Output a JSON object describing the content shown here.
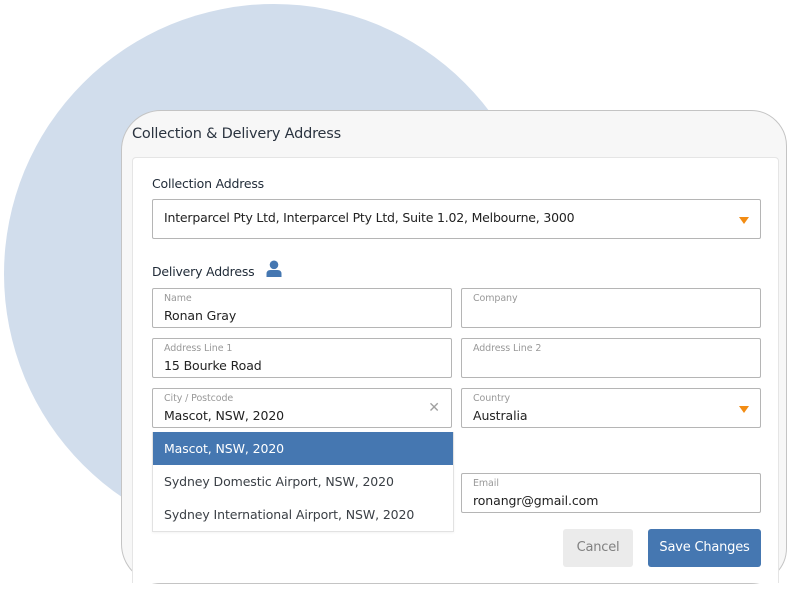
{
  "colors": {
    "accent": "#4577b1",
    "caret": "#f28c13",
    "background_circle": "#d1ddec"
  },
  "dialog": {
    "title": "Collection & Delivery Address"
  },
  "collection": {
    "label": "Collection Address",
    "selected": "Interparcel Pty Ltd, Interparcel Pty Ltd, Suite 1.02, Melbourne, 3000",
    "caret_icon": "caret-down-icon"
  },
  "delivery": {
    "label": "Delivery Address",
    "contact_icon": "user-icon",
    "fields": {
      "name": {
        "label": "Name",
        "value": "Ronan Gray"
      },
      "company": {
        "label": "Company",
        "value": ""
      },
      "address1": {
        "label": "Address Line 1",
        "value": "15 Bourke Road"
      },
      "address2": {
        "label": "Address Line 2",
        "value": ""
      },
      "city": {
        "label": "City / Postcode",
        "value": "Mascot, NSW, 2020",
        "clear_icon": "close-icon"
      },
      "country": {
        "label": "Country",
        "value": "Australia"
      },
      "email": {
        "label": "Email",
        "value": "ronangr@gmail.com"
      }
    },
    "city_suggestions": [
      {
        "label": "Mascot, NSW, 2020",
        "active": true
      },
      {
        "label": "Sydney Domestic Airport, NSW, 2020",
        "active": false
      },
      {
        "label": "Sydney International Airport, NSW, 2020",
        "active": false
      }
    ]
  },
  "actions": {
    "cancel": "Cancel",
    "save": "Save Changes"
  }
}
